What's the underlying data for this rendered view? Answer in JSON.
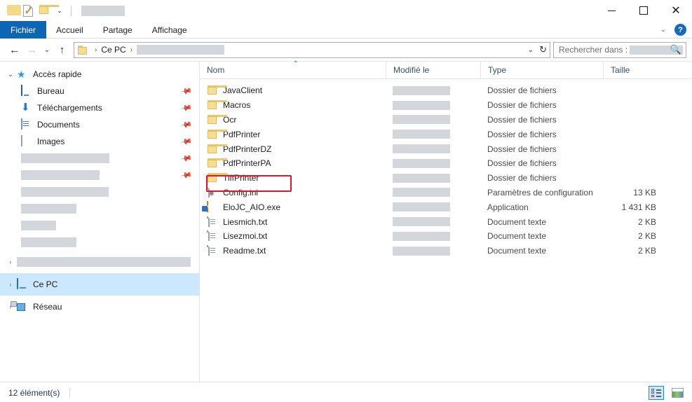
{
  "window": {
    "title_redacted": true,
    "quick_access": [
      {
        "icon": "folder-plain-icon",
        "label": ""
      },
      {
        "icon": "properties-icon",
        "label": ""
      },
      {
        "icon": "new-folder-icon",
        "label": ""
      },
      {
        "icon": "customize-qat-chevron-icon",
        "label": "⌄"
      }
    ],
    "controls": {
      "minimize": "—",
      "maximize": "□",
      "close": "✕"
    }
  },
  "ribbon": {
    "tabs": [
      {
        "label": "Fichier",
        "active": true
      },
      {
        "label": "Accueil",
        "active": false
      },
      {
        "label": "Partage",
        "active": false
      },
      {
        "label": "Affichage",
        "active": false
      }
    ],
    "collapse_chevron": "⌄",
    "help_label": "?"
  },
  "address": {
    "back": "←",
    "forward": "→",
    "recent_chevron": "⌄",
    "up": "↑",
    "breadcrumb": [
      {
        "type": "folder-icon",
        "label": ""
      },
      {
        "type": "text",
        "label": "Ce PC"
      },
      {
        "type": "redacted",
        "label": ""
      }
    ],
    "separator": "›",
    "dropdown_chevron": "⌄",
    "refresh": "↻",
    "search_label": "Rechercher dans :",
    "search_value_redacted": true,
    "search_icon": "🔍"
  },
  "sidebar": {
    "items": [
      {
        "label": "Accès rapide",
        "icon": "star-icon",
        "chevron": "⌄",
        "level": 0,
        "pinned": false,
        "selected": false,
        "redacted": false
      },
      {
        "label": "Bureau",
        "icon": "desktop-icon",
        "level": 1,
        "pinned": true,
        "selected": false,
        "redacted": false
      },
      {
        "label": "Téléchargements",
        "icon": "download-icon",
        "level": 1,
        "pinned": true,
        "selected": false,
        "redacted": false
      },
      {
        "label": "Documents",
        "icon": "documents-icon",
        "level": 1,
        "pinned": true,
        "selected": false,
        "redacted": false
      },
      {
        "label": "Images",
        "icon": "pictures-icon",
        "level": 1,
        "pinned": true,
        "selected": false,
        "redacted": false
      },
      {
        "label": "",
        "icon": "none",
        "level": 1,
        "pinned": true,
        "selected": false,
        "redacted": true,
        "redact_width": 126
      },
      {
        "label": "",
        "icon": "none",
        "level": 1,
        "pinned": true,
        "selected": false,
        "redacted": true,
        "redact_width": 112
      },
      {
        "label": "",
        "icon": "none",
        "level": 1,
        "pinned": false,
        "selected": false,
        "redacted": true,
        "redact_width": 125
      },
      {
        "label": "",
        "icon": "none",
        "level": 1,
        "pinned": false,
        "selected": false,
        "redacted": true,
        "redact_width": 79
      },
      {
        "label": "",
        "icon": "none",
        "level": 1,
        "pinned": false,
        "selected": false,
        "redacted": true,
        "redact_width": 50
      },
      {
        "label": "",
        "icon": "none",
        "level": 1,
        "pinned": false,
        "selected": false,
        "redacted": true,
        "redact_width": 79
      },
      {
        "label": "",
        "icon": "none",
        "chevron": "›",
        "level": 0,
        "pinned": false,
        "selected": false,
        "redacted": true,
        "redact_width": 248
      },
      {
        "label": "Ce PC",
        "icon": "computer-icon",
        "chevron": "›",
        "level": 0,
        "pinned": false,
        "selected": true,
        "redacted": false
      },
      {
        "label": "Réseau",
        "icon": "network-icon",
        "chevron": "›",
        "level": 0,
        "pinned": false,
        "selected": false,
        "redacted": false
      }
    ]
  },
  "filelist": {
    "columns": [
      {
        "key": "name",
        "label": "Nom",
        "sorted": true,
        "sort_caret": "⌃"
      },
      {
        "key": "modified",
        "label": "Modifié le",
        "sorted": false
      },
      {
        "key": "type",
        "label": "Type",
        "sorted": false
      },
      {
        "key": "size",
        "label": "Taille",
        "sorted": false
      }
    ],
    "rows": [
      {
        "name": "JavaClient",
        "icon": "folder-icon",
        "modified_redacted": true,
        "type": "Dossier de fichiers",
        "size": "",
        "highlighted": false
      },
      {
        "name": "Macros",
        "icon": "folder-icon",
        "modified_redacted": true,
        "type": "Dossier de fichiers",
        "size": "",
        "highlighted": false
      },
      {
        "name": "Ocr",
        "icon": "folder-icon",
        "modified_redacted": true,
        "type": "Dossier de fichiers",
        "size": "",
        "highlighted": false
      },
      {
        "name": "PdfPrinter",
        "icon": "folder-icon",
        "modified_redacted": true,
        "type": "Dossier de fichiers",
        "size": "",
        "highlighted": false
      },
      {
        "name": "PdfPrinterDZ",
        "icon": "folder-icon",
        "modified_redacted": true,
        "type": "Dossier de fichiers",
        "size": "",
        "highlighted": false
      },
      {
        "name": "PdfPrinterPA",
        "icon": "folder-icon",
        "modified_redacted": true,
        "type": "Dossier de fichiers",
        "size": "",
        "highlighted": false
      },
      {
        "name": "TiffPrinter",
        "icon": "folder-icon",
        "modified_redacted": true,
        "type": "Dossier de fichiers",
        "size": "",
        "highlighted": false
      },
      {
        "name": "Config.ini",
        "icon": "ini-file-icon",
        "modified_redacted": true,
        "type": "Paramètres de configuration",
        "size": "13 KB",
        "highlighted": false
      },
      {
        "name": "EloJC_AIO.exe",
        "icon": "application-icon",
        "modified_redacted": true,
        "type": "Application",
        "size": "1 431 KB",
        "highlighted": true
      },
      {
        "name": "Liesmich.txt",
        "icon": "text-file-icon",
        "modified_redacted": true,
        "type": "Document texte",
        "size": "2 KB",
        "highlighted": false
      },
      {
        "name": "Lisezmoi.txt",
        "icon": "text-file-icon",
        "modified_redacted": true,
        "type": "Document texte",
        "size": "2 KB",
        "highlighted": false
      },
      {
        "name": "Readme.txt",
        "icon": "text-file-icon",
        "modified_redacted": true,
        "type": "Document texte",
        "size": "2 KB",
        "highlighted": false
      }
    ]
  },
  "statusbar": {
    "item_count": "12 élément(s)",
    "views": [
      {
        "name": "details-view",
        "active": true
      },
      {
        "name": "large-icons-view",
        "active": false
      }
    ]
  },
  "colors": {
    "accent": "#0d66b5",
    "selection": "#cce8ff",
    "highlight_red": "#e8132b",
    "folder_yellow": "#f8dd95",
    "redact_gray": "#d3d7dc"
  }
}
